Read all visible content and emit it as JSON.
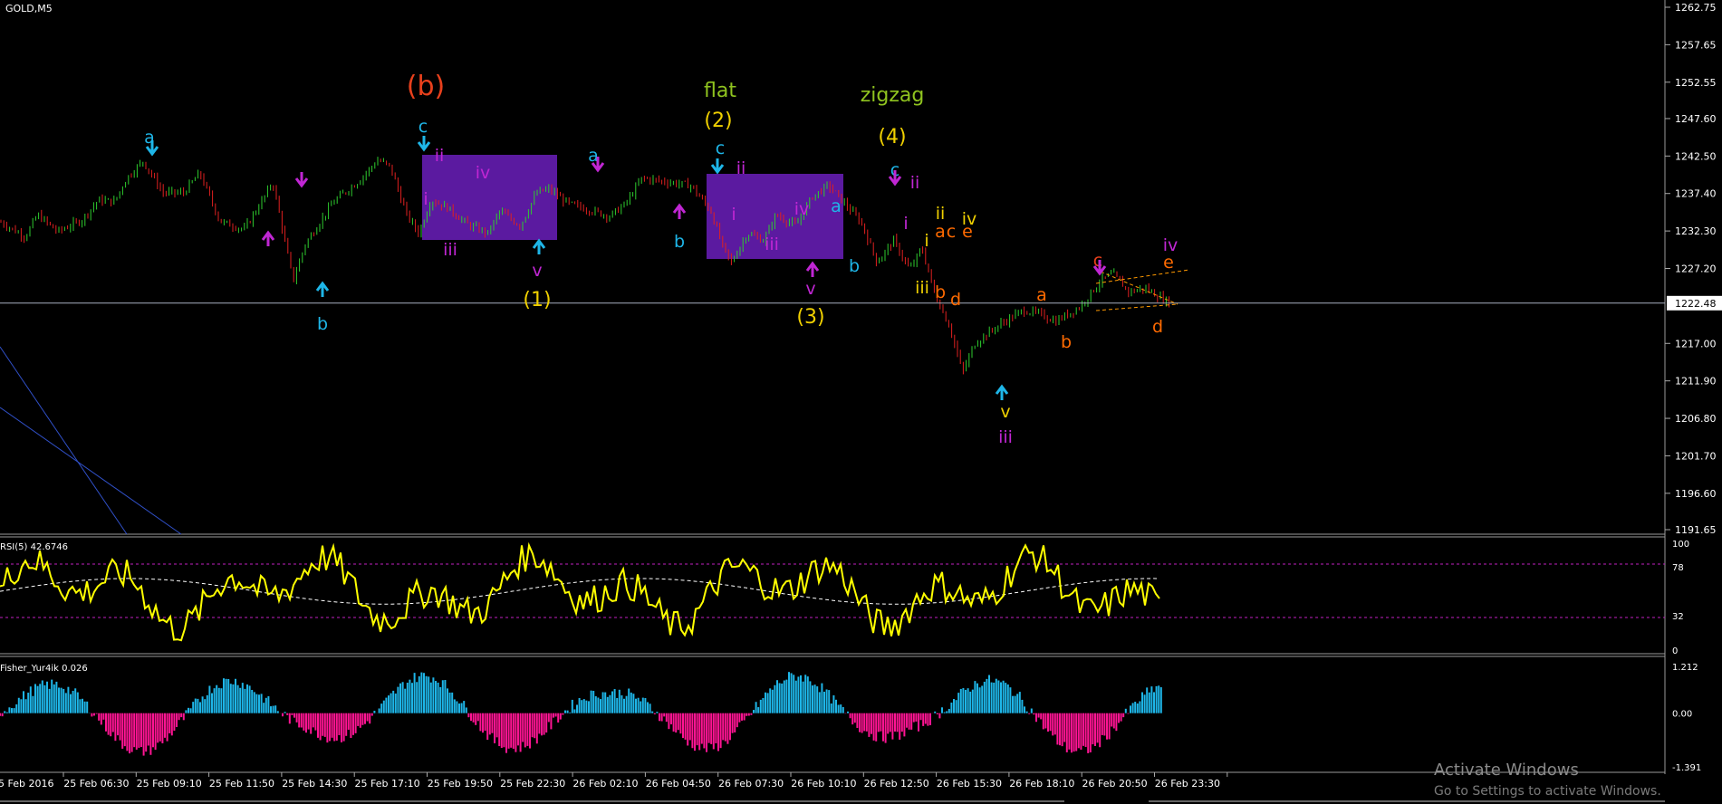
{
  "window": {
    "symbol_label": "GOLD,M5"
  },
  "chart_data": [
    {
      "type": "line",
      "subtype": "candlestick",
      "title": "GOLD,M5",
      "ylim": [
        1191.65,
        1262.75
      ],
      "y_ticks": [
        "1262.75",
        "1257.65",
        "1252.55",
        "1247.60",
        "1242.50",
        "1237.40",
        "1232.30",
        "1227.20",
        "1222.48",
        "1217.00",
        "1211.90",
        "1206.80",
        "1201.70",
        "1196.60",
        "1191.65"
      ],
      "current_price": "1222.48",
      "x_ticks": [
        "5 Feb 2016",
        "25 Feb 06:30",
        "25 Feb 09:10",
        "25 Feb 11:50",
        "25 Feb 14:30",
        "25 Feb 17:10",
        "25 Feb 19:50",
        "25 Feb 22:30",
        "26 Feb 02:10",
        "26 Feb 04:50",
        "26 Feb 07:30",
        "26 Feb 10:10",
        "26 Feb 12:50",
        "26 Feb 15:30",
        "26 Feb 18:10",
        "26 Feb 20:50",
        "26 Feb 23:30"
      ],
      "price_path": [
        [
          0,
          1233.5
        ],
        [
          0.03,
          1231.5
        ],
        [
          0.045,
          1234.5
        ],
        [
          0.07,
          1232.2
        ],
        [
          0.1,
          1233.8
        ],
        [
          0.12,
          1236.5
        ],
        [
          0.14,
          1236.3
        ],
        [
          0.155,
          1239.5
        ],
        [
          0.175,
          1241.8
        ],
        [
          0.2,
          1237.5
        ],
        [
          0.225,
          1237.5
        ],
        [
          0.245,
          1240.2
        ],
        [
          0.27,
          1233.6
        ],
        [
          0.3,
          1232.5
        ],
        [
          0.325,
          1237.0
        ],
        [
          0.335,
          1239.0
        ],
        [
          0.36,
          1225.5
        ],
        [
          0.375,
          1230.5
        ],
        [
          0.41,
          1236.3
        ],
        [
          0.44,
          1239.0
        ],
        [
          0.465,
          1242.0
        ],
        [
          0.48,
          1241.0
        ],
        [
          0.5,
          1234.5
        ],
        [
          0.515,
          1232.0
        ],
        [
          0.53,
          1236.5
        ],
        [
          0.55,
          1235.5
        ],
        [
          0.575,
          1233.2
        ],
        [
          0.6,
          1232.0
        ],
        [
          0.615,
          1235.0
        ],
        [
          0.64,
          1233.0
        ],
        [
          0.66,
          1237.5
        ],
        [
          0.675,
          1238.0
        ],
        [
          0.7,
          1236.0
        ],
        [
          0.73,
          1235.0
        ],
        [
          0.75,
          1234.3
        ],
        [
          0.77,
          1236.0
        ],
        [
          0.79,
          1239.5
        ],
        [
          0.82,
          1239.0
        ],
        [
          0.85,
          1238.5
        ],
        [
          0.875,
          1235.0
        ],
        [
          0.89,
          1230.0
        ],
        [
          0.9,
          1228.0
        ],
        [
          0.92,
          1232.0
        ],
        [
          0.94,
          1231.0
        ],
        [
          0.955,
          1234.5
        ],
        [
          0.98,
          1233.0
        ],
        [
          1.0,
          1237.0
        ],
        [
          1.02,
          1238.5
        ],
        [
          1.04,
          1236.0
        ],
        [
          1.06,
          1233.5
        ],
        [
          1.08,
          1228.0
        ],
        [
          1.1,
          1231.0
        ],
        [
          1.12,
          1227.0
        ],
        [
          1.135,
          1230.0
        ],
        [
          1.15,
          1224.0
        ],
        [
          1.17,
          1219.0
        ],
        [
          1.185,
          1213.0
        ],
        [
          1.2,
          1217.0
        ],
        [
          1.23,
          1219.5
        ],
        [
          1.26,
          1221.5
        ],
        [
          1.28,
          1221.0
        ],
        [
          1.3,
          1220.0
        ],
        [
          1.33,
          1222.0
        ],
        [
          1.355,
          1225.5
        ],
        [
          1.37,
          1226.5
        ],
        [
          1.39,
          1224.0
        ],
        [
          1.41,
          1224.5
        ],
        [
          1.44,
          1222.5
        ]
      ],
      "annotations": {
        "heading_labels": [
          "(b)",
          "flat",
          "(2)",
          "zigzag",
          "(4)",
          "(1)",
          "(3)"
        ],
        "wave_labels": [
          "a",
          "b",
          "c",
          "ii",
          "i",
          "iii",
          "iv",
          "v",
          "a",
          "b",
          "c",
          "i",
          "ii",
          "iii",
          "iv",
          "v",
          "a",
          "b",
          "c",
          "ii",
          "i",
          "i",
          "ii",
          "iii",
          "a",
          "c",
          "b",
          "d",
          "iv",
          "e",
          "v",
          "iii",
          "a",
          "b",
          "c",
          "d",
          "e",
          "iv"
        ]
      }
    },
    {
      "type": "line",
      "title": "RSI(5) 42.6746",
      "ylim": [
        0,
        100
      ],
      "y_ticks": [
        "100",
        "78",
        "32",
        "0"
      ],
      "levels": [
        78,
        32
      ],
      "series": [
        {
          "name": "RSI(5)",
          "values_note": "oscillating 0-100"
        }
      ]
    },
    {
      "type": "bar",
      "title": "Fisher_Yur4ik 0.026",
      "ylim": [
        -1.391,
        1.212
      ],
      "y_ticks": [
        "1.212",
        "0.00",
        "-1.391"
      ],
      "colors": {
        "positive": "#1eb6e8",
        "negative": "#ff1493"
      }
    }
  ],
  "indicators": {
    "rsi_label": "RSI(5) 42.6746",
    "fisher_label": "Fisher_Yur4ik 0.026"
  },
  "watermark": {
    "line1": "Activate Windows",
    "line2": "Go to Settings to activate Windows."
  },
  "colors": {
    "background": "#000000",
    "candle_up": "#2ecc2e",
    "candle_down": "#e02020",
    "rsi": "#ffff00",
    "box": "#5a1a9e",
    "axis_text": "#ffffff"
  }
}
